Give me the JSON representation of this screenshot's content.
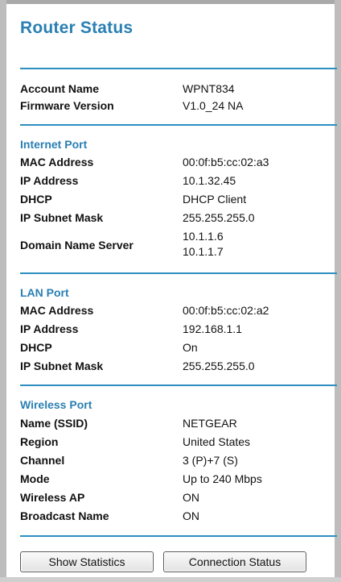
{
  "title": "Router Status",
  "account": {
    "rows": [
      {
        "label": "Account Name",
        "value": "WPNT834"
      },
      {
        "label": "Firmware Version",
        "value": "V1.0_24 NA"
      }
    ]
  },
  "internet_port": {
    "heading": "Internet Port",
    "rows": [
      {
        "label": "MAC Address",
        "value": "00:0f:b5:cc:02:a3"
      },
      {
        "label": "IP Address",
        "value": "10.1.32.45"
      },
      {
        "label": "DHCP",
        "value": "DHCP Client"
      },
      {
        "label": "IP Subnet Mask",
        "value": "255.255.255.0"
      }
    ],
    "dns": {
      "label": "Domain Name Server",
      "value1": "10.1.1.6",
      "value2": "10.1.1.7"
    }
  },
  "lan_port": {
    "heading": "LAN Port",
    "rows": [
      {
        "label": "MAC Address",
        "value": "00:0f:b5:cc:02:a2"
      },
      {
        "label": "IP Address",
        "value": "192.168.1.1"
      },
      {
        "label": "DHCP",
        "value": "On"
      },
      {
        "label": "IP Subnet Mask",
        "value": "255.255.255.0"
      }
    ]
  },
  "wireless_port": {
    "heading": "Wireless Port",
    "rows": [
      {
        "label": "Name (SSID)",
        "value": "NETGEAR"
      },
      {
        "label": "Region",
        "value": "United States"
      },
      {
        "label": "Channel",
        "value": "3 (P)+7 (S)"
      },
      {
        "label": "Mode",
        "value": "Up to 240 Mbps"
      },
      {
        "label": "Wireless AP",
        "value": "ON"
      },
      {
        "label": "Broadcast Name",
        "value": "ON"
      }
    ]
  },
  "buttons": {
    "show_statistics": "Show Statistics",
    "connection_status": "Connection Status"
  },
  "colors": {
    "accent": "#2a7fb3",
    "rule": "#2d8fc0"
  }
}
